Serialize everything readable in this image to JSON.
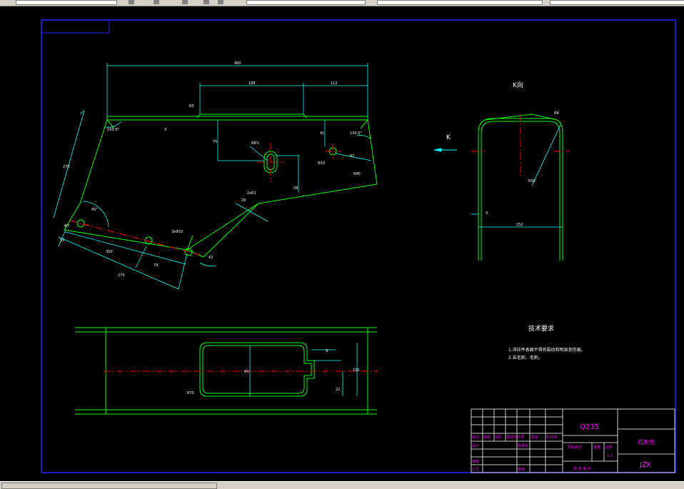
{
  "drawing": {
    "overall_length": "480",
    "dim_slot_length": "198",
    "dim_right_length": "112",
    "dim_tab_r": "R3",
    "dim_left_angle": "150.9°",
    "dim_right_angle": "130.0°",
    "dim_wall_3": "3",
    "dim_75": "75",
    "dim_41": "41",
    "dim_67": "67",
    "dim_28": "28",
    "dim_R8": "R8½",
    "dim_phi10": "Φ10",
    "dim_R40": "R40",
    "dim_2xR1": "2xR1",
    "dim_270": "270",
    "dim_45": "45°",
    "dim_phi": "Φ7",
    "dim_3xphi10": "3xΦ10",
    "dim_350": "350",
    "dim_74": "74",
    "dim_270b": "270",
    "dim_55": "55",
    "dim_42": "42",
    "dim_29": "29",
    "dim_R40b": "R40",
    "view_label": "K向",
    "k_arrow_label": "K",
    "k_dim_152": "152",
    "k_dim_3": "3",
    "k_dim_R50": "R50",
    "k_dim_R": "R8",
    "bottom_dim_9": "9",
    "bottom_dim_60": "60",
    "bottom_dim_22": "22",
    "bottom_dim_100": "100",
    "bottom_dim_R70": "R70",
    "tech_title": "技术要求",
    "tech_note_1": "1.冲压件表面不得有裂纹和明显划伤痕。",
    "tech_note_2": "2.去毛刺、毛刺。"
  },
  "title_block": {
    "material": "Q235",
    "part_name": "机架壳",
    "code": "JZK",
    "scale_label": "比例",
    "scale_value": "1:2",
    "weight_label": "重量",
    "stage_label": "阶段标记",
    "sheets_label": "共 张 第 张",
    "col_mark": "标记",
    "col_count": "处数",
    "col_zone": "分区",
    "col_change": "更改文件号",
    "col_sign": "签名",
    "col_date": "年月日",
    "designer": "设计",
    "standard": "标准化",
    "checker": "审核",
    "process": "工艺",
    "approve": "批准"
  },
  "colors": {
    "background": "#000000",
    "frame": "#2626ff",
    "outline": "#00ff00",
    "dimension": "#00ffff",
    "centerline": "#ff0000",
    "text_white": "#ffffff",
    "magenta": "#ff00ff"
  }
}
